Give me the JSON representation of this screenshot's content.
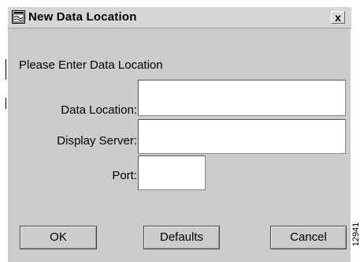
{
  "window": {
    "title": "New Data Location",
    "icon": "app-window-icon"
  },
  "form": {
    "prompt": "Please Enter Data Location",
    "data_location": {
      "label": "Data Location:",
      "value": ""
    },
    "display_server": {
      "label": "Display Server:",
      "value": ""
    },
    "port": {
      "label": "Port:",
      "value": ""
    }
  },
  "buttons": {
    "ok": "OK",
    "defaults": "Defaults",
    "cancel": "Cancel",
    "close": "x"
  },
  "figure_number": "12941"
}
